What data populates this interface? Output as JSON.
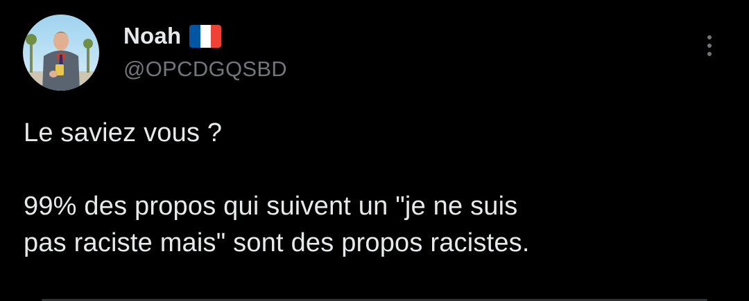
{
  "author": {
    "display_name": "Noah",
    "flag_icon": "france-flag-icon",
    "handle": "@OPCDGQSBD"
  },
  "menu": {
    "icon": "more-vertical-icon"
  },
  "tweet": {
    "line1": "Le saviez vous ?",
    "line2": "99% des propos qui suivent un \"je ne suis",
    "line3": "pas raciste mais\" sont des propos racistes."
  },
  "colors": {
    "background": "#000000",
    "text_primary": "#e7e9ea",
    "text_secondary": "#71767b",
    "flag_blue": "#0055a4",
    "flag_white": "#ffffff",
    "flag_red": "#ef4135"
  }
}
